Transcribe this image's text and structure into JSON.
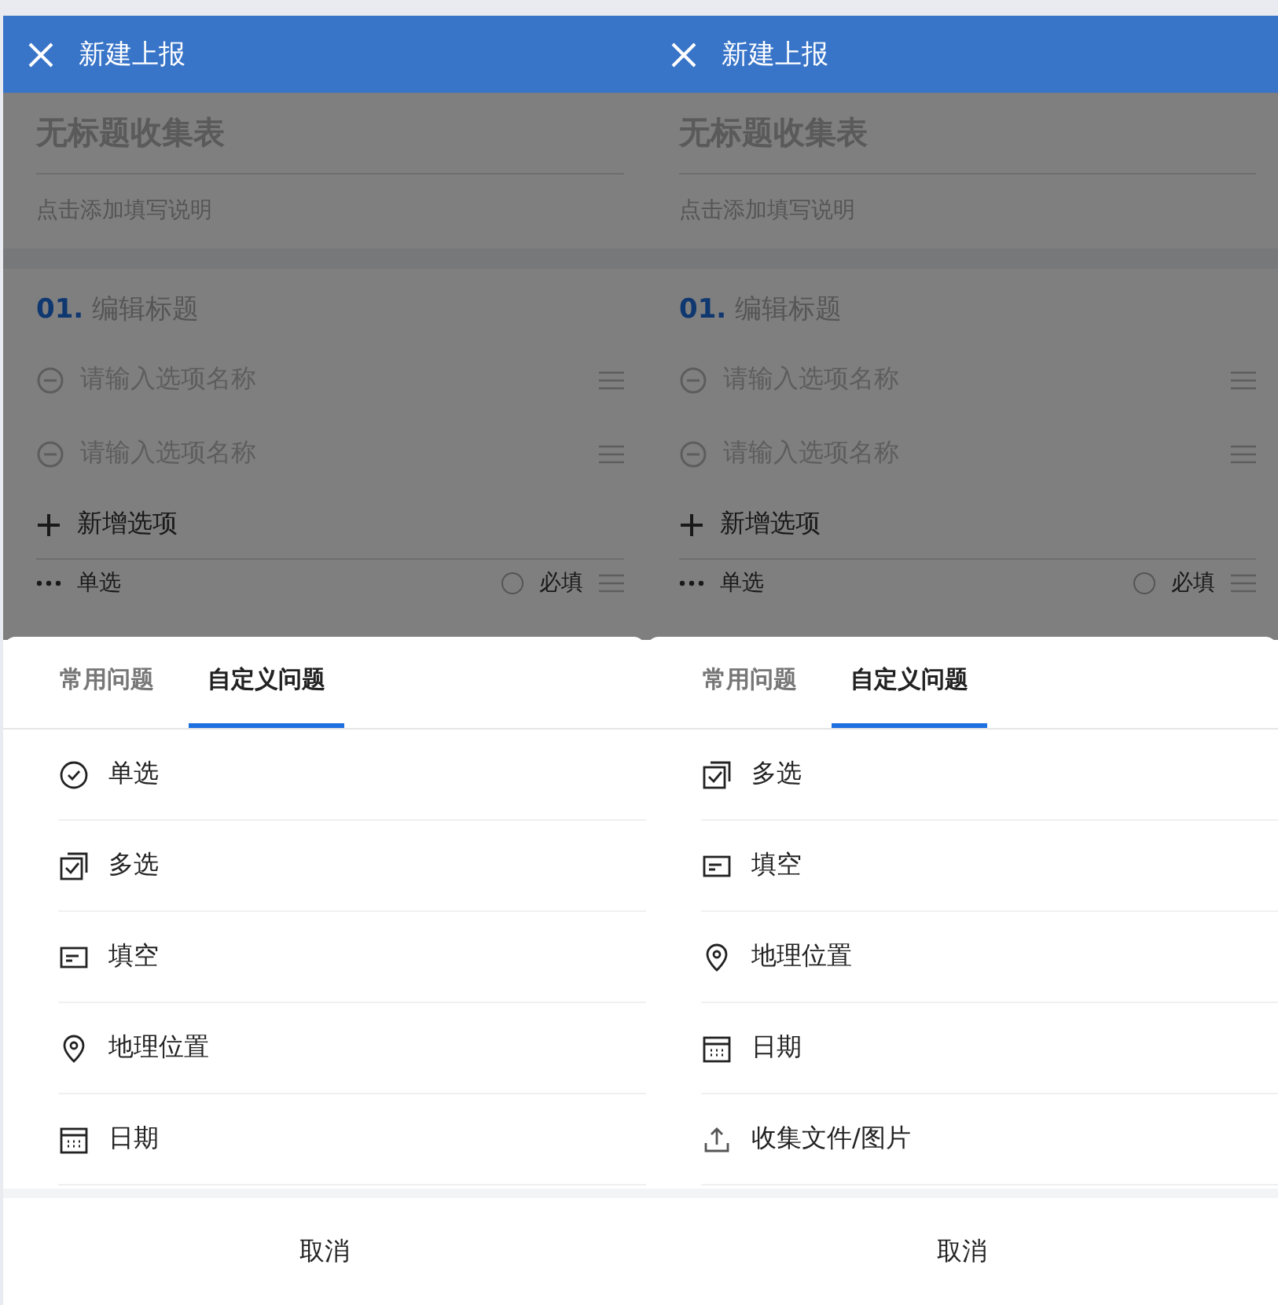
{
  "screens": [
    {
      "header": {
        "title": "新建上报"
      },
      "form": {
        "title": "无标题收集表",
        "description": "点击添加填写说明",
        "question": {
          "number": "01.",
          "title": "编辑标题",
          "options": [
            "请输入选项名称",
            "请输入选项名称"
          ],
          "add_option": "新增选项",
          "type": "单选",
          "required": {
            "label": "必填",
            "checked": false
          }
        }
      },
      "sheet": {
        "tabs": [
          {
            "label": "常用问题",
            "selected": false
          },
          {
            "label": "自定义问题",
            "selected": true
          }
        ],
        "items": [
          {
            "kind": "single",
            "label": "单选"
          },
          {
            "kind": "multi",
            "label": "多选"
          },
          {
            "kind": "text",
            "label": "填空"
          },
          {
            "kind": "location",
            "label": "地理位置"
          },
          {
            "kind": "date",
            "label": "日期"
          }
        ],
        "cancel": "取消"
      }
    },
    {
      "header": {
        "title": "新建上报"
      },
      "form": {
        "title": "无标题收集表",
        "description": "点击添加填写说明",
        "question": {
          "number": "01.",
          "title": "编辑标题",
          "options": [
            "请输入选项名称",
            "请输入选项名称"
          ],
          "add_option": "新增选项",
          "type": "单选",
          "required": {
            "label": "必填",
            "checked": false
          }
        }
      },
      "sheet": {
        "tabs": [
          {
            "label": "常用问题",
            "selected": false
          },
          {
            "label": "自定义问题",
            "selected": true
          }
        ],
        "items": [
          {
            "kind": "multi",
            "label": "多选"
          },
          {
            "kind": "text",
            "label": "填空"
          },
          {
            "kind": "location",
            "label": "地理位置"
          },
          {
            "kind": "date",
            "label": "日期"
          },
          {
            "kind": "upload",
            "label": "收集文件/图片"
          }
        ],
        "cancel": "取消"
      }
    }
  ]
}
